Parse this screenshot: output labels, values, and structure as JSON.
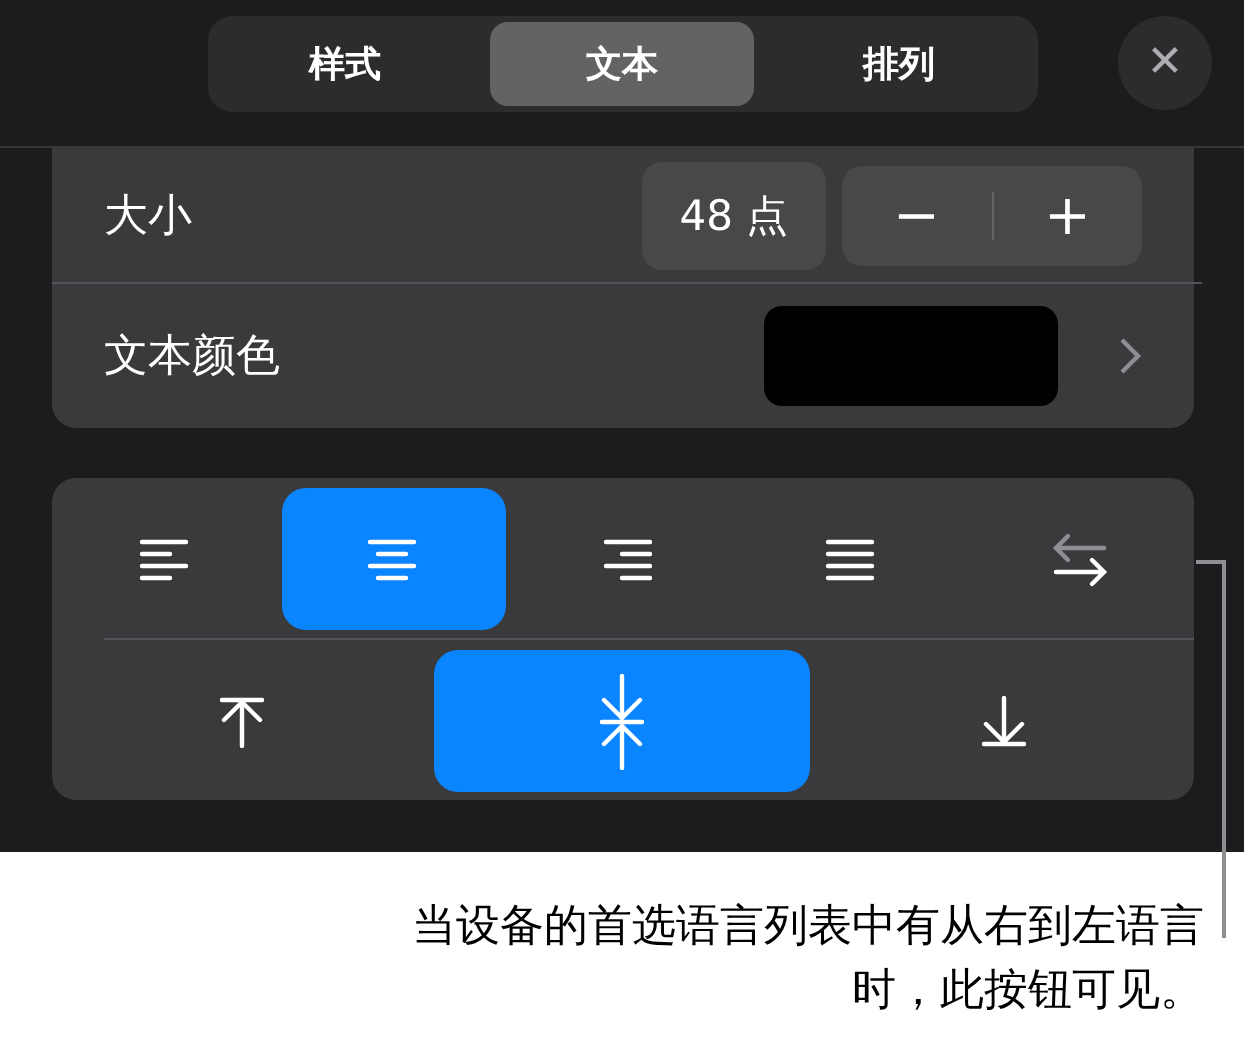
{
  "tabs": [
    {
      "label": "样式",
      "selected": false
    },
    {
      "label": "文本",
      "selected": true
    },
    {
      "label": "排列",
      "selected": false
    }
  ],
  "close_button": {
    "label": "✕"
  },
  "size_row": {
    "label": "大小",
    "value": "48 点",
    "decrement": "−",
    "increment": "+"
  },
  "color_row": {
    "label": "文本颜色",
    "color": "#000000"
  },
  "alignment_buttons": [
    {
      "kind": "left",
      "selected": false
    },
    {
      "kind": "center",
      "selected": true
    },
    {
      "kind": "right",
      "selected": false
    },
    {
      "kind": "justify",
      "selected": false
    },
    {
      "kind": "direction",
      "selected": false
    }
  ],
  "vertical_buttons": [
    {
      "kind": "top",
      "selected": false
    },
    {
      "kind": "middle",
      "selected": true
    },
    {
      "kind": "bottom",
      "selected": false
    }
  ],
  "callout": "当设备的首选语言列表中有从右到左语言时，此按钮可见。"
}
